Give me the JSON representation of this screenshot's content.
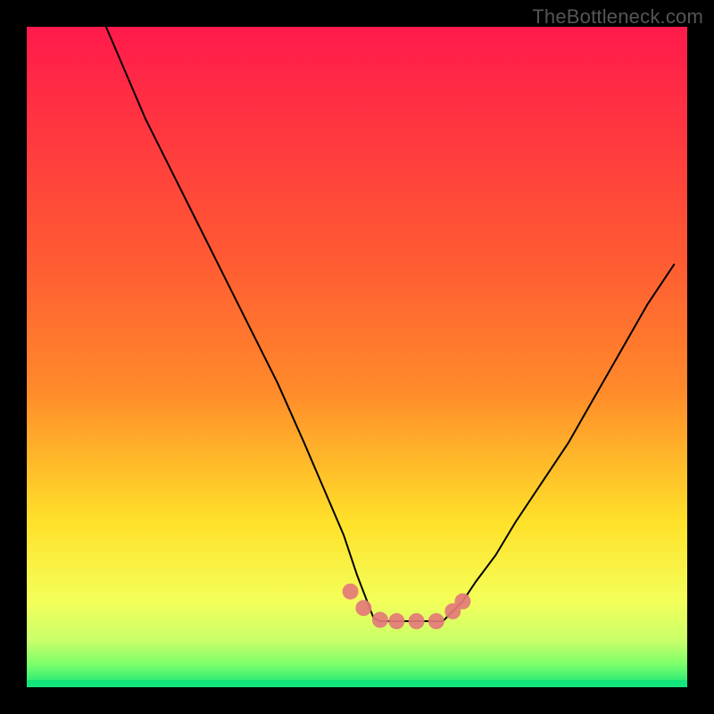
{
  "watermark": "TheBottleneck.com",
  "chart_data": {
    "type": "line",
    "title": "",
    "xlabel": "",
    "ylabel": "",
    "xlim": [
      0,
      100
    ],
    "ylim": [
      0,
      100
    ],
    "grid": false,
    "background_gradient": {
      "top": "#ff1a4b",
      "mid1": "#ff8a2a",
      "mid2": "#ffe12a",
      "mid3": "#f4ff5a",
      "bottom": "#13e57a"
    },
    "series": [
      {
        "name": "curve-left",
        "color": "#000000",
        "x": [
          12,
          15,
          18,
          22,
          26,
          30,
          34,
          38,
          42,
          45,
          48,
          50,
          52.5,
          53.5
        ],
        "y": [
          100,
          93,
          86,
          78,
          70,
          62,
          54,
          46,
          37,
          30,
          23,
          17,
          10.5,
          10
        ]
      },
      {
        "name": "curve-right",
        "color": "#000000",
        "x": [
          63,
          64,
          66,
          68,
          71,
          74,
          78,
          82,
          86,
          90,
          94,
          98
        ],
        "y": [
          10,
          11,
          13,
          16,
          20,
          25,
          31,
          37,
          44,
          51,
          58,
          64
        ]
      },
      {
        "name": "floor",
        "color": "#000000",
        "x": [
          53.5,
          63
        ],
        "y": [
          10,
          10
        ]
      }
    ],
    "markers": [
      {
        "name": "marker-1",
        "x": 49.0,
        "y": 14.5
      },
      {
        "name": "marker-2",
        "x": 51.0,
        "y": 12.0
      },
      {
        "name": "marker-3",
        "x": 53.5,
        "y": 10.2
      },
      {
        "name": "marker-4",
        "x": 56.0,
        "y": 10.0
      },
      {
        "name": "marker-5",
        "x": 59.0,
        "y": 10.0
      },
      {
        "name": "marker-6",
        "x": 62.0,
        "y": 10.0
      },
      {
        "name": "marker-7",
        "x": 64.5,
        "y": 11.5
      },
      {
        "name": "marker-8",
        "x": 66.0,
        "y": 13.0
      }
    ]
  }
}
